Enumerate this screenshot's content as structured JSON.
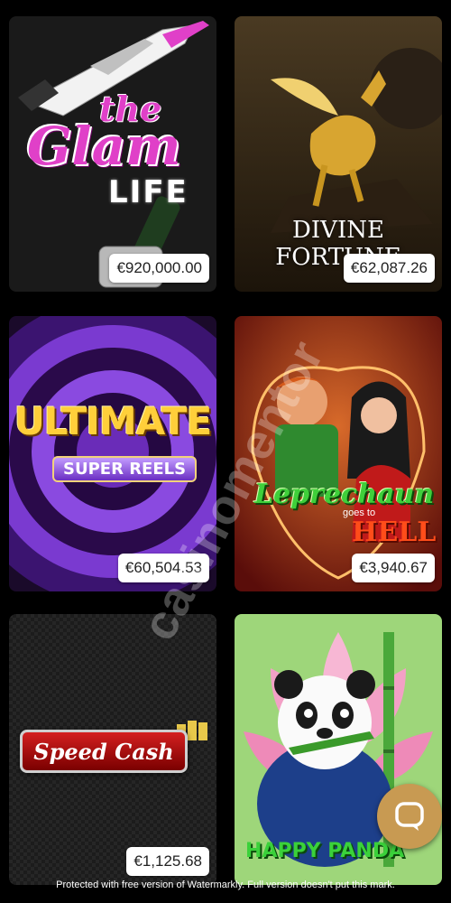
{
  "tiles": [
    {
      "name": "glam-life",
      "title_the": "the",
      "title_main": "Glam",
      "title_life": "LIFE",
      "jackpot": "€920,000.00"
    },
    {
      "name": "divine-fortune",
      "title": "DIVINE FORTUNE",
      "jackpot": "€62,087.26"
    },
    {
      "name": "ultimate-super-reels",
      "title": "ULTIMATE",
      "subtitle": "SUPER REELS",
      "jackpot": "€60,504.53"
    },
    {
      "name": "leprechaun-goes-to-hell",
      "title": "Leprechaun",
      "subtitle": "goes to",
      "title2": "HELL",
      "jackpot": "€3,940.67"
    },
    {
      "name": "speed-cash",
      "title": "Speed Cash",
      "jackpot": "€1,125.68"
    },
    {
      "name": "happy-panda",
      "title": "HAPPY PANDA",
      "jackpot": ""
    }
  ],
  "watermark": "casinomentor",
  "footer": "Protected with free version of Watermarkly. Full version doesn't put this mark.",
  "icons": {
    "chat": "chat-bubble-icon"
  },
  "colors": {
    "background": "#000000",
    "chat_button": "#c89a52",
    "badge_bg": "#ffffff"
  }
}
